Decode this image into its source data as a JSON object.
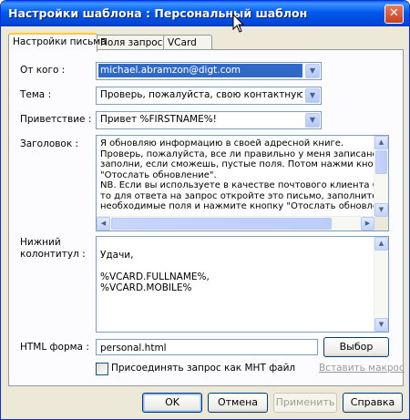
{
  "window": {
    "title": "Настройки шаблона : Персональный шаблон",
    "close_glyph": "✕"
  },
  "tabs": [
    {
      "label": "Настройки письма",
      "active": true
    },
    {
      "label": "Поля запроса",
      "active": false
    },
    {
      "label": "VCard",
      "active": false
    }
  ],
  "form": {
    "from_label": "От кого :",
    "from_value": "michael.abramzon@digt.com",
    "subject_label": "Тема :",
    "subject_value": "Проверь, пожалуйста, свою контактную информ",
    "greeting_label": "Приветствие :",
    "greeting_value": "Привет %FIRSTNAME%!",
    "header_label": "Заголовок :",
    "header_text": "Я обновляю информацию в своей адресной книге.\nПроверь, пожалуйста, все ли правильно у меня записано и\nзаполни, если сможешь, пустые поля. Потом нажми кнопку\n\"Отослать обновление\".\nNB. Если вы используете в качестве почтового клиента Outlook,\nто для ответа на запрос откройте это письмо, заполните\nнеобходимые поля и нажмите кнопку \"Отослать обновления\".",
    "footer_label_1": "Нижний",
    "footer_label_2": "колонтитул :",
    "footer_text": "Удачи,\n\n%VCARD.FULLNAME%,\n%VCARD.MOBILE%",
    "html_label": "HTML форма :",
    "html_value": "personal.html",
    "browse_button": "Выбор",
    "attach_checkbox_label": "Присоединять запрос как MHT файл",
    "attach_checked": false,
    "insert_macro_link": "Вставить макрос"
  },
  "buttons": {
    "ok": "OK",
    "cancel": "Отмена",
    "apply": "Применить",
    "help": "Справка"
  },
  "icons": {
    "dropdown": "▼",
    "scroll_up": "▲",
    "scroll_down": "▼",
    "scroll_left": "◀",
    "scroll_right": "▶"
  },
  "colors": {
    "titlebar": "#0054e3",
    "selection": "#316ac5",
    "dialog_bg": "#ece9d8"
  }
}
